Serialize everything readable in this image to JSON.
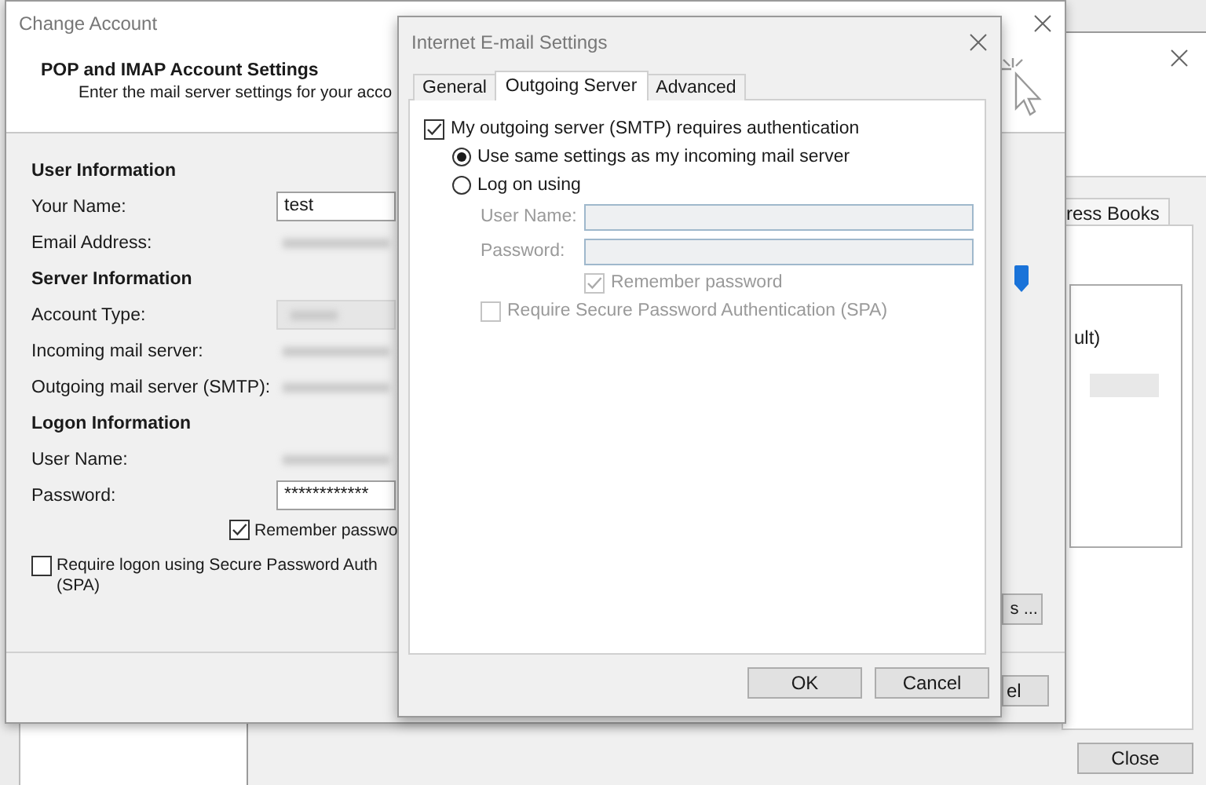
{
  "account_settings": {
    "tab": "ress Books",
    "list_item": "ult)",
    "close_button": "Close"
  },
  "change_account": {
    "title": "Change Account",
    "heading": "POP and IMAP Account Settings",
    "subheading": "Enter the mail server settings for your acco",
    "sections": [
      {
        "title": "User Information",
        "fields": [
          {
            "label": "Your Name:",
            "kind": "text",
            "value": "test"
          },
          {
            "label": "Email Address:",
            "kind": "redacted"
          }
        ]
      },
      {
        "title": "Server Information",
        "fields": [
          {
            "label": "Account Type:",
            "kind": "redacted-box"
          },
          {
            "label": "Incoming mail server:",
            "kind": "redacted"
          },
          {
            "label": "Outgoing mail server (SMTP):",
            "kind": "redacted"
          }
        ]
      },
      {
        "title": "Logon Information",
        "fields": [
          {
            "label": "User Name:",
            "kind": "redacted"
          },
          {
            "label": "Password:",
            "kind": "text",
            "value": "************"
          }
        ]
      }
    ],
    "remember_password": {
      "label": "Remember passwo",
      "checked": true
    },
    "require_spa": {
      "label": "Require logon using Secure Password Auth\n(SPA)",
      "checked": false
    },
    "side_buttons": [
      "s ...",
      "el"
    ]
  },
  "email_settings": {
    "title": "Internet E-mail Settings",
    "tabs": [
      {
        "label": "General",
        "selected": false
      },
      {
        "label": "Outgoing Server",
        "selected": true
      },
      {
        "label": "Advanced",
        "selected": false
      }
    ],
    "smtp_auth": {
      "label": "My outgoing server (SMTP) requires authentication",
      "checked": true
    },
    "options": [
      {
        "label": "Use same settings as my incoming mail server",
        "selected": true
      },
      {
        "label": "Log on using",
        "selected": false
      }
    ],
    "logon_fields": [
      {
        "label": "User Name:",
        "disabled": true
      },
      {
        "label": "Password:",
        "disabled": true
      }
    ],
    "remember_password": {
      "label": "Remember password",
      "checked": true,
      "disabled": true
    },
    "require_spa": {
      "label": "Require Secure Password Authentication (SPA)",
      "checked": false,
      "disabled": true
    },
    "buttons": [
      "OK",
      "Cancel"
    ]
  }
}
